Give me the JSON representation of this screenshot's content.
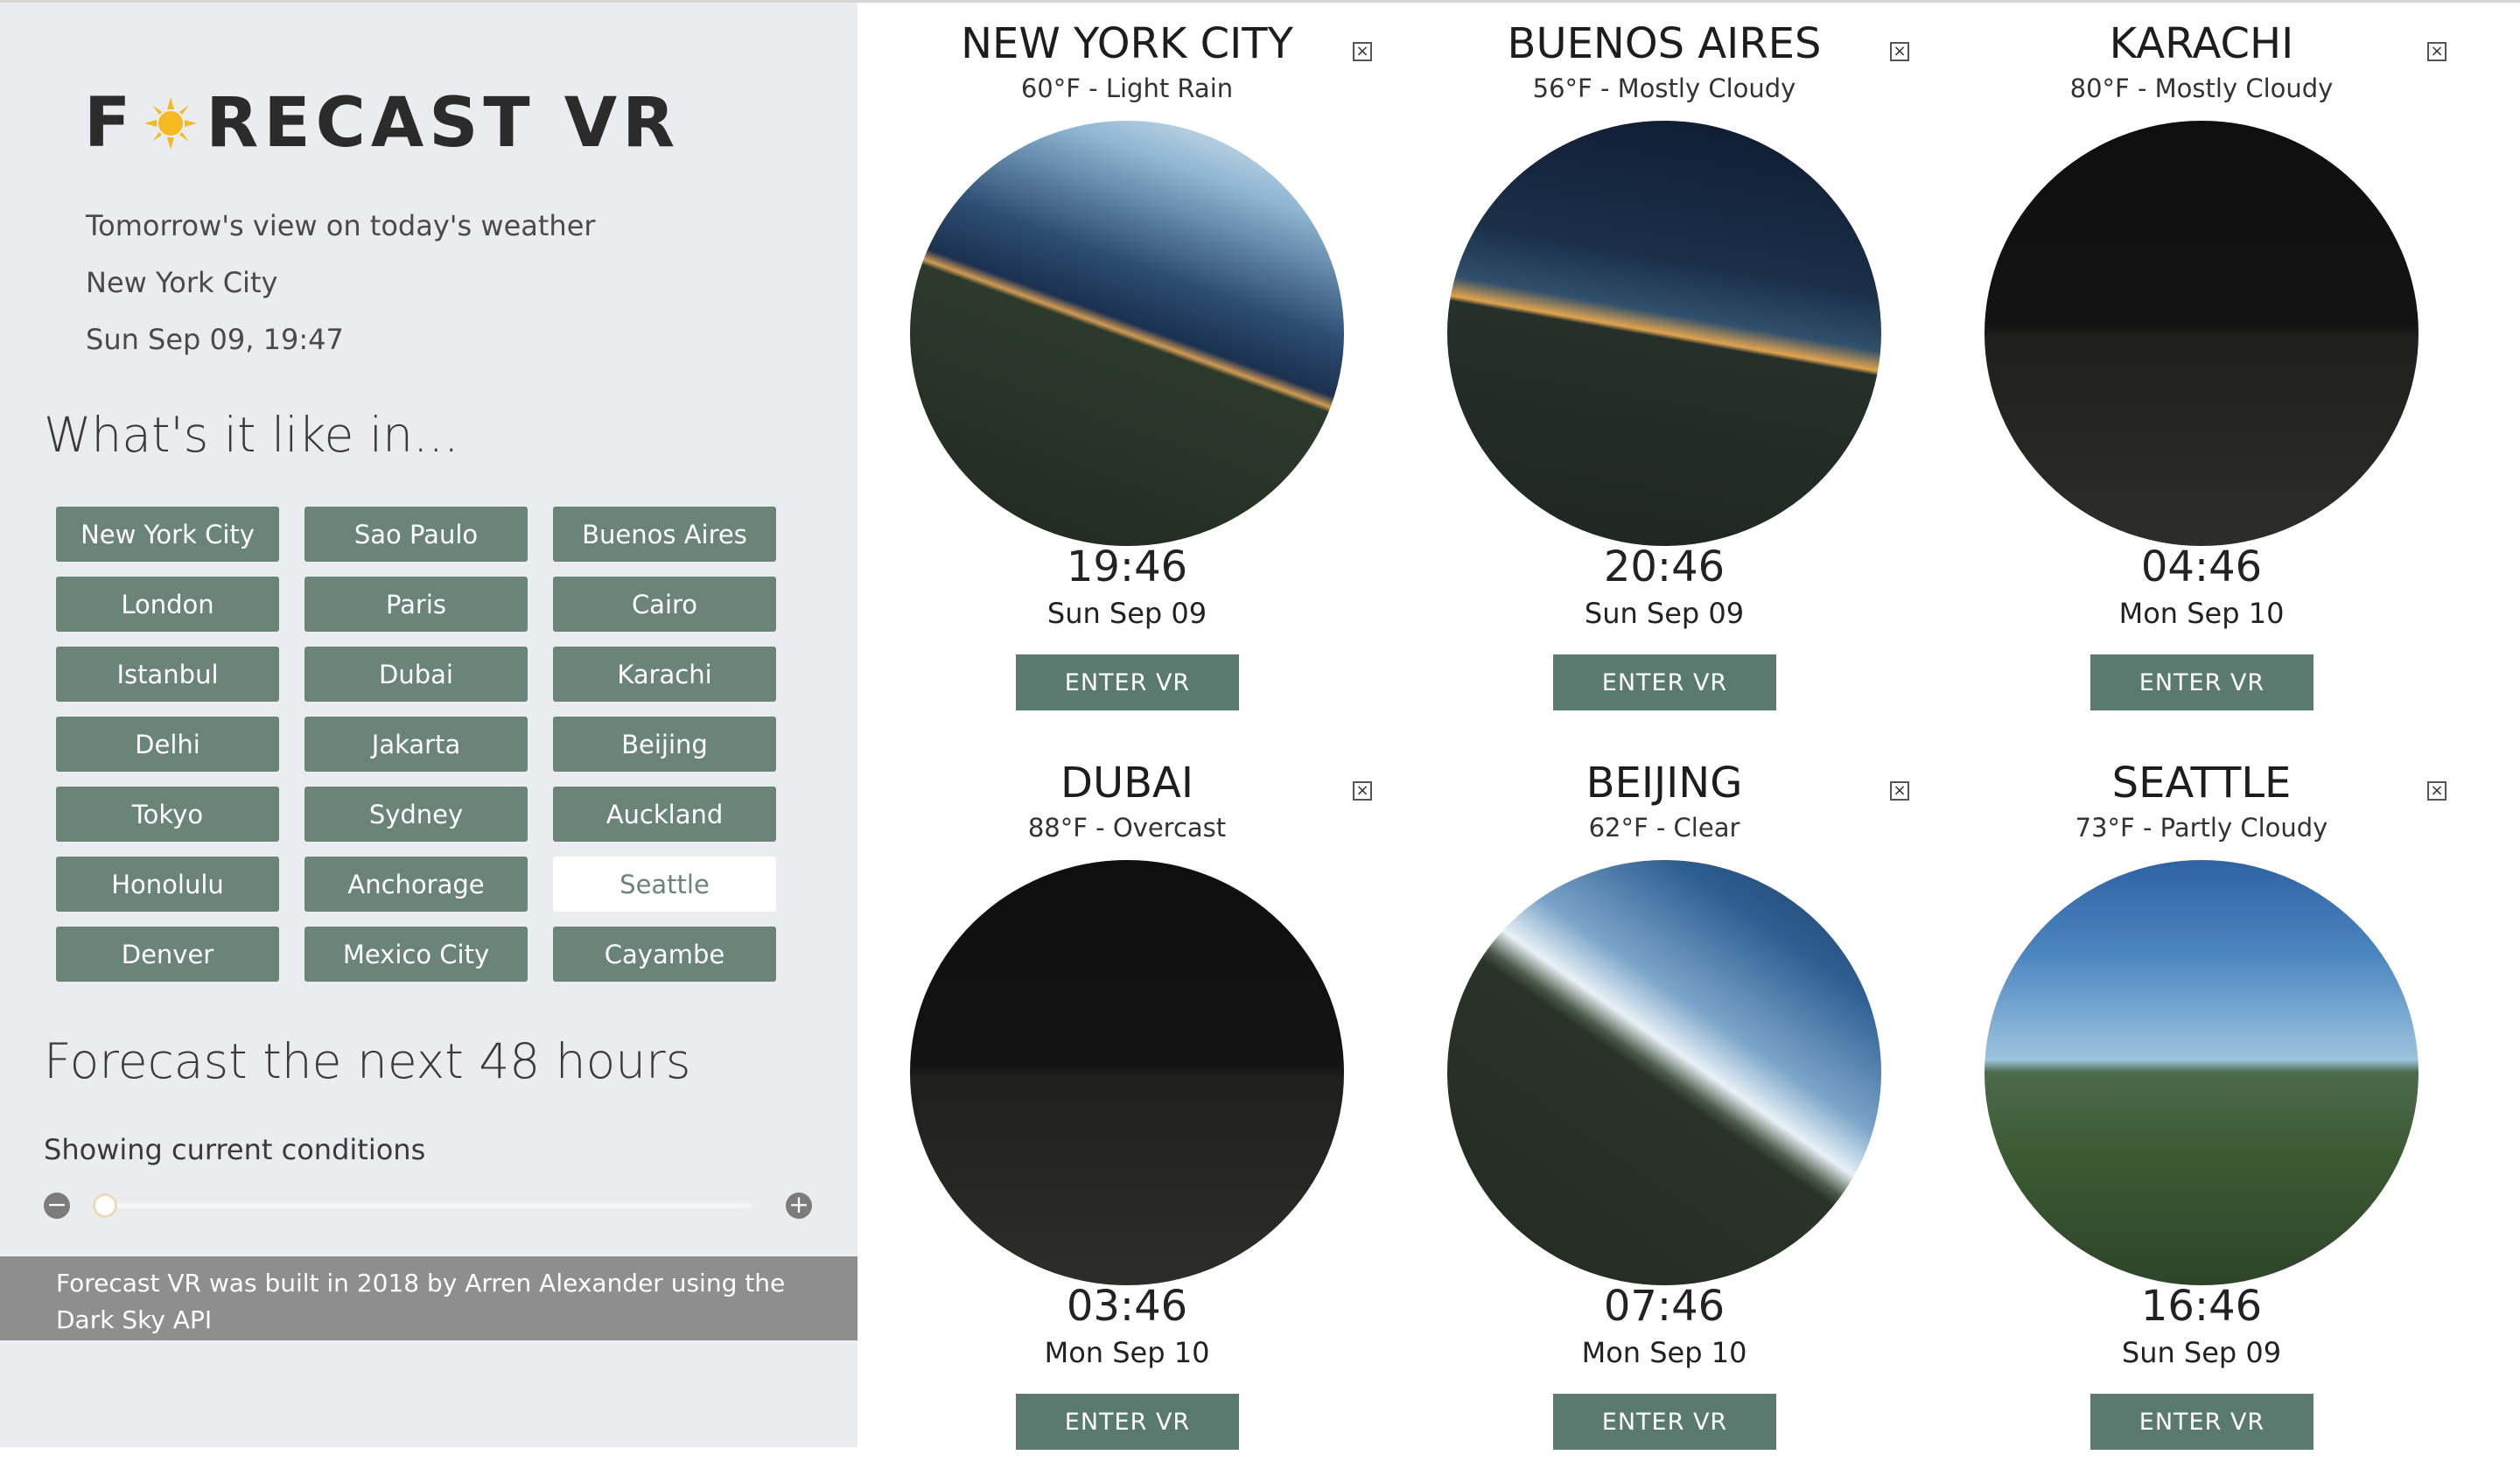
{
  "app": {
    "title_left": "F",
    "title_right": "RECAST VR",
    "tagline": "Tomorrow's view on today's weather",
    "location": "New York City",
    "datetime": "Sun Sep 09, 19:47"
  },
  "cities_heading": "What's it like in...",
  "cities": [
    {
      "label": "New York City",
      "active": false
    },
    {
      "label": "Sao Paulo",
      "active": false
    },
    {
      "label": "Buenos Aires",
      "active": false
    },
    {
      "label": "London",
      "active": false
    },
    {
      "label": "Paris",
      "active": false
    },
    {
      "label": "Cairo",
      "active": false
    },
    {
      "label": "Istanbul",
      "active": false
    },
    {
      "label": "Dubai",
      "active": false
    },
    {
      "label": "Karachi",
      "active": false
    },
    {
      "label": "Delhi",
      "active": false
    },
    {
      "label": "Jakarta",
      "active": false
    },
    {
      "label": "Beijing",
      "active": false
    },
    {
      "label": "Tokyo",
      "active": false
    },
    {
      "label": "Sydney",
      "active": false
    },
    {
      "label": "Auckland",
      "active": false
    },
    {
      "label": "Honolulu",
      "active": false
    },
    {
      "label": "Anchorage",
      "active": false
    },
    {
      "label": "Seattle",
      "active": true
    },
    {
      "label": "Denver",
      "active": false
    },
    {
      "label": "Mexico City",
      "active": false
    },
    {
      "label": "Cayambe",
      "active": false
    }
  ],
  "forecast": {
    "heading": "Forecast the next 48 hours",
    "status": "Showing current conditions",
    "minus_icon": "minus-icon",
    "plus_icon": "plus-icon",
    "slider_value": 0
  },
  "footer": {
    "text": "Forecast VR was built in 2018 by Arren Alexander using the Dark Sky API"
  },
  "cards": [
    {
      "city": "NEW YORK CITY",
      "conditions": "60°F - Light Rain",
      "time": "19:46",
      "date": "Sun Sep 09",
      "button": "ENTER VR",
      "sky": "dusk-rain"
    },
    {
      "city": "BUENOS AIRES",
      "conditions": "56°F - Mostly Cloudy",
      "time": "20:46",
      "date": "Sun Sep 09",
      "button": "ENTER VR",
      "sky": "dusk"
    },
    {
      "city": "KARACHI",
      "conditions": "80°F - Mostly Cloudy",
      "time": "04:46",
      "date": "Mon Sep 10",
      "button": "ENTER VR",
      "sky": "night"
    },
    {
      "city": "DUBAI",
      "conditions": "88°F - Overcast",
      "time": "03:46",
      "date": "Mon Sep 10",
      "button": "ENTER VR",
      "sky": "night"
    },
    {
      "city": "BEIJING",
      "conditions": "62°F - Clear",
      "time": "07:46",
      "date": "Mon Sep 10",
      "button": "ENTER VR",
      "sky": "morning"
    },
    {
      "city": "SEATTLE",
      "conditions": "73°F - Partly Cloudy",
      "time": "16:46",
      "date": "Sun Sep 09",
      "button": "ENTER VR",
      "sky": "day"
    }
  ],
  "colors": {
    "button": "#6b847a",
    "enter_button": "#5a7a70",
    "sidebar_bg": "#ebecef",
    "footer_bg": "#8e8e8e"
  }
}
